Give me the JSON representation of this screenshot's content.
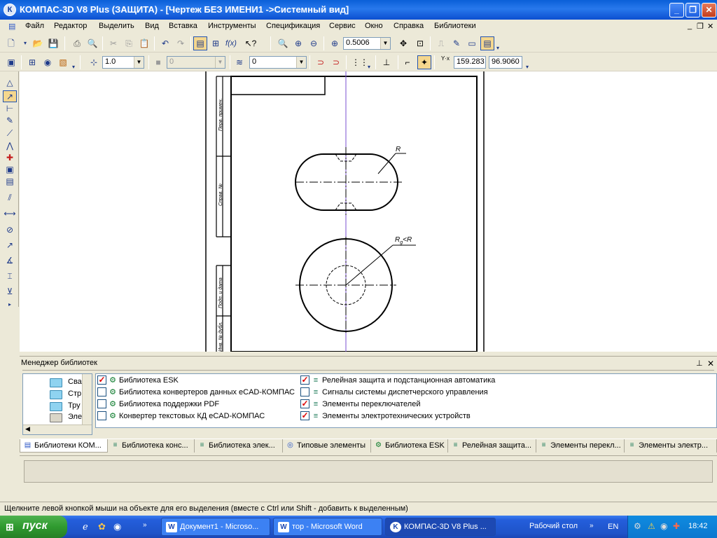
{
  "window": {
    "title": "КОМПАС-3D V8 Plus (ЗАЩИТА) - [Чертеж БЕЗ ИМЕНИ1 ->Системный вид]",
    "app_icon": "К"
  },
  "menu": {
    "items": [
      "Файл",
      "Редактор",
      "Выделить",
      "Вид",
      "Вставка",
      "Инструменты",
      "Спецификация",
      "Сервис",
      "Окно",
      "Справка",
      "Библиотеки"
    ]
  },
  "toolbar": {
    "zoom_value": "0.5006",
    "step_value": "1.0",
    "style_value": "0",
    "layer_value": "0",
    "coord_x": "159.283",
    "coord_y": "96.9060",
    "coord_label": "Y·x"
  },
  "drawing": {
    "label_R": "R",
    "label_Rlt": "R",
    "label_Rlt_sub": "g",
    "label_Rlt_rest": "<R",
    "stamp_1": "Перв. примен.",
    "stamp_2": "Справ. №",
    "stamp_3": "Подп. и дата",
    "stamp_4": "Инв. № дубл."
  },
  "library_manager": {
    "title": "Менеджер библиотек",
    "tree": [
      "Сва",
      "Стр",
      "Тру",
      "Эле"
    ],
    "items_left": [
      {
        "label": "Библиотека ESK",
        "checked": true
      },
      {
        "label": "Библиотека конвертеров данных eCAD-КОМПАС",
        "checked": false
      },
      {
        "label": "Библиотека поддержки PDF",
        "checked": false
      },
      {
        "label": "Конвертер текстовых КД eCAD-КОМПАС",
        "checked": false
      }
    ],
    "items_right": [
      {
        "label": "Релейная защита и подстанционная автоматика",
        "checked": true
      },
      {
        "label": "Сигналы системы диспетчерского управления",
        "checked": false
      },
      {
        "label": "Элементы переключателей",
        "checked": true
      },
      {
        "label": "Элементы электротехнических устройств",
        "checked": true
      }
    ]
  },
  "tabs": [
    "Библиотеки КОМ...",
    "Библиотека конс...",
    "Библиотека элек...",
    "Типовые элементы",
    "Библиотека ESK",
    "Релейная защита...",
    "Элементы перекл...",
    "Элементы электр..."
  ],
  "status_text": "Щелкните левой кнопкой мыши на объекте для его выделения (вместе с Ctrl или Shift - добавить к выделенным)",
  "taskbar": {
    "start_label": "пуск",
    "buttons": [
      "Документ1 - Microso...",
      "тор - Microsoft Word",
      "КОМПАС-3D V8 Plus ..."
    ],
    "desktop_label": "Рабочий стол",
    "lang": "EN",
    "clock": "18:42"
  }
}
